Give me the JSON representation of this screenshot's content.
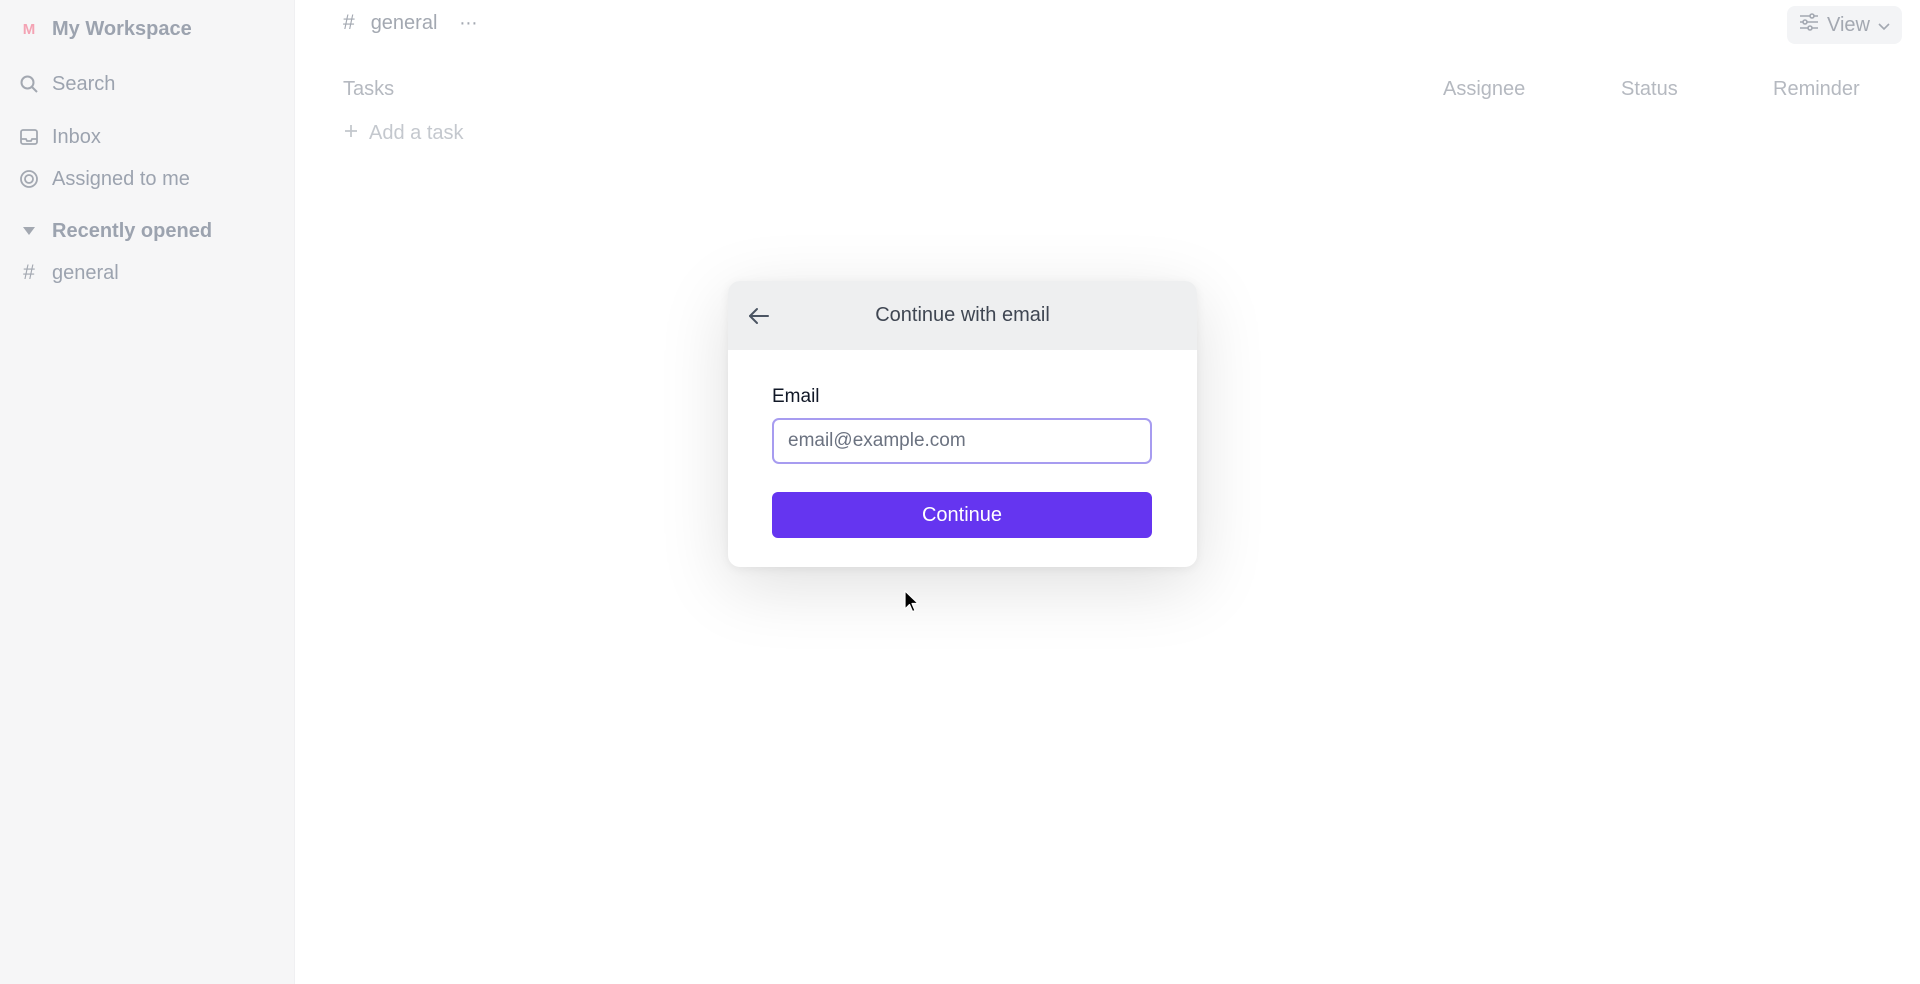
{
  "sidebar": {
    "workspace_initial": "M",
    "workspace_name": "My Workspace",
    "search_label": "Search",
    "inbox_label": "Inbox",
    "assigned_label": "Assigned to me",
    "recent_section_label": "Recently opened",
    "recent_items": [
      {
        "label": "general"
      }
    ]
  },
  "header": {
    "channel": "general",
    "view_label": "View"
  },
  "tasks": {
    "columns": {
      "tasks": "Tasks",
      "assignee": "Assignee",
      "status": "Status",
      "reminder": "Reminder"
    },
    "add_task_label": "Add a task"
  },
  "modal": {
    "title": "Continue with email",
    "email_label": "Email",
    "email_placeholder": "email@example.com",
    "email_value": "",
    "submit_label": "Continue"
  },
  "colors": {
    "accent": "#6535f0",
    "input_focus_border": "#a79cf0",
    "modal_header_bg": "#eeeff0",
    "sidebar_bg": "#f6f6f7"
  }
}
